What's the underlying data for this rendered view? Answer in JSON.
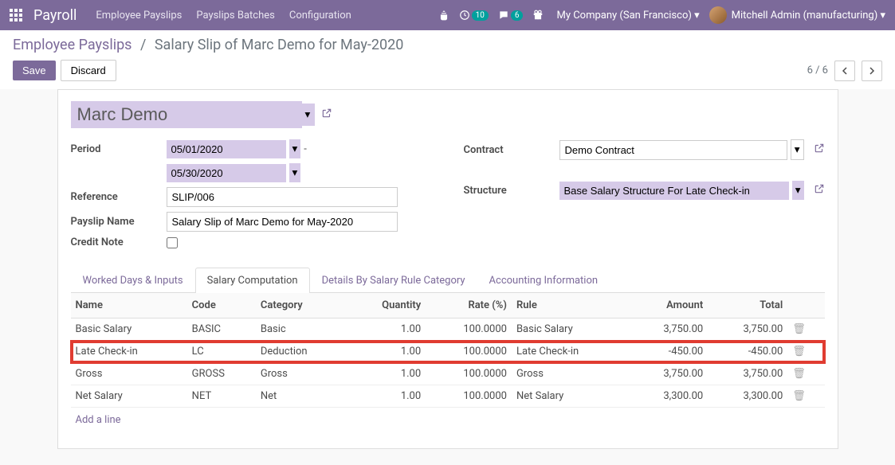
{
  "navbar": {
    "brand": "Payroll",
    "items": [
      "Employee Payslips",
      "Payslips Batches",
      "Configuration"
    ],
    "activity_count": "10",
    "message_count": "6",
    "company": "My Company (San Francisco)",
    "user": "Mitchell Admin (manufacturing)"
  },
  "breadcrumb": {
    "parent": "Employee Payslips",
    "current": "Salary Slip of Marc Demo for May-2020"
  },
  "buttons": {
    "save": "Save",
    "discard": "Discard"
  },
  "pager": {
    "text": "6 / 6"
  },
  "form": {
    "employee": "Marc Demo",
    "period_label": "Period",
    "period_from": "05/01/2020",
    "period_to": "05/30/2020",
    "reference_label": "Reference",
    "reference": "SLIP/006",
    "payslip_name_label": "Payslip Name",
    "payslip_name": "Salary Slip of Marc Demo for May-2020",
    "credit_note_label": "Credit Note",
    "contract_label": "Contract",
    "contract": "Demo Contract",
    "structure_label": "Structure",
    "structure": "Base Salary Structure For Late Check-in"
  },
  "tabs": [
    "Worked Days & Inputs",
    "Salary Computation",
    "Details By Salary Rule Category",
    "Accounting Information"
  ],
  "table": {
    "headers": {
      "name": "Name",
      "code": "Code",
      "category": "Category",
      "quantity": "Quantity",
      "rate": "Rate (%)",
      "rule": "Rule",
      "amount": "Amount",
      "total": "Total"
    },
    "rows": [
      {
        "name": "Basic Salary",
        "code": "BASIC",
        "category": "Basic",
        "quantity": "1.00",
        "rate": "100.0000",
        "rule": "Basic Salary",
        "amount": "3,750.00",
        "total": "3,750.00",
        "hl": false
      },
      {
        "name": "Late Check-in",
        "code": "LC",
        "category": "Deduction",
        "quantity": "1.00",
        "rate": "100.0000",
        "rule": "Late Check-in",
        "amount": "-450.00",
        "total": "-450.00",
        "hl": true
      },
      {
        "name": "Gross",
        "code": "GROSS",
        "category": "Gross",
        "quantity": "1.00",
        "rate": "100.0000",
        "rule": "Gross",
        "amount": "3,750.00",
        "total": "3,750.00",
        "hl": false
      },
      {
        "name": "Net Salary",
        "code": "NET",
        "category": "Net",
        "quantity": "1.00",
        "rate": "100.0000",
        "rule": "Net Salary",
        "amount": "3,300.00",
        "total": "3,300.00",
        "hl": false
      }
    ],
    "add_line": "Add a line"
  }
}
